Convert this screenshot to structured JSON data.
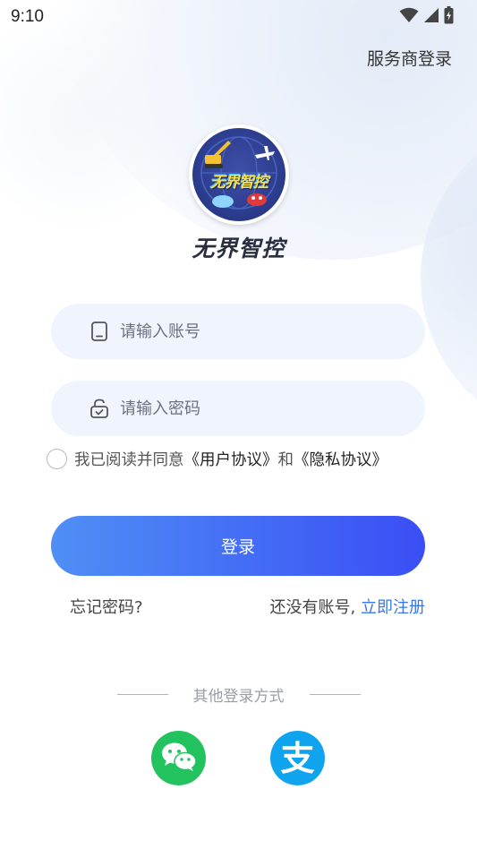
{
  "status_bar": {
    "time": "9:10",
    "icons": [
      "wifi-icon",
      "signal-icon",
      "battery-icon"
    ]
  },
  "header": {
    "provider_login": "服务商登录"
  },
  "brand": {
    "logo_text": "无界智控",
    "app_name": "无界智控"
  },
  "form": {
    "account": {
      "value": "",
      "placeholder": "请输入账号",
      "icon": "phone-icon"
    },
    "password": {
      "value": "",
      "placeholder": "请输入密码",
      "icon": "lock-icon"
    }
  },
  "agreement": {
    "prefix": "我已阅读并同意",
    "user_agreement": "《用户协议》",
    "conjunction": "和",
    "privacy_policy": "《隐私协议》",
    "checked": false
  },
  "actions": {
    "login_label": "登录",
    "forgot_password": "忘记密码?",
    "no_account": "还没有账号,",
    "register_now": "立即注册"
  },
  "other_login": {
    "label": "其他登录方式",
    "providers": [
      "wechat-icon",
      "alipay-icon"
    ],
    "alipay_glyph": "支"
  },
  "colors": {
    "button_gradient_start": "#4f8ff5",
    "button_gradient_end": "#3a4ef5",
    "field_bg": "#f0f5fd",
    "link": "#3a76f0",
    "wechat": "#22c35e",
    "alipay": "#10a4ee"
  }
}
